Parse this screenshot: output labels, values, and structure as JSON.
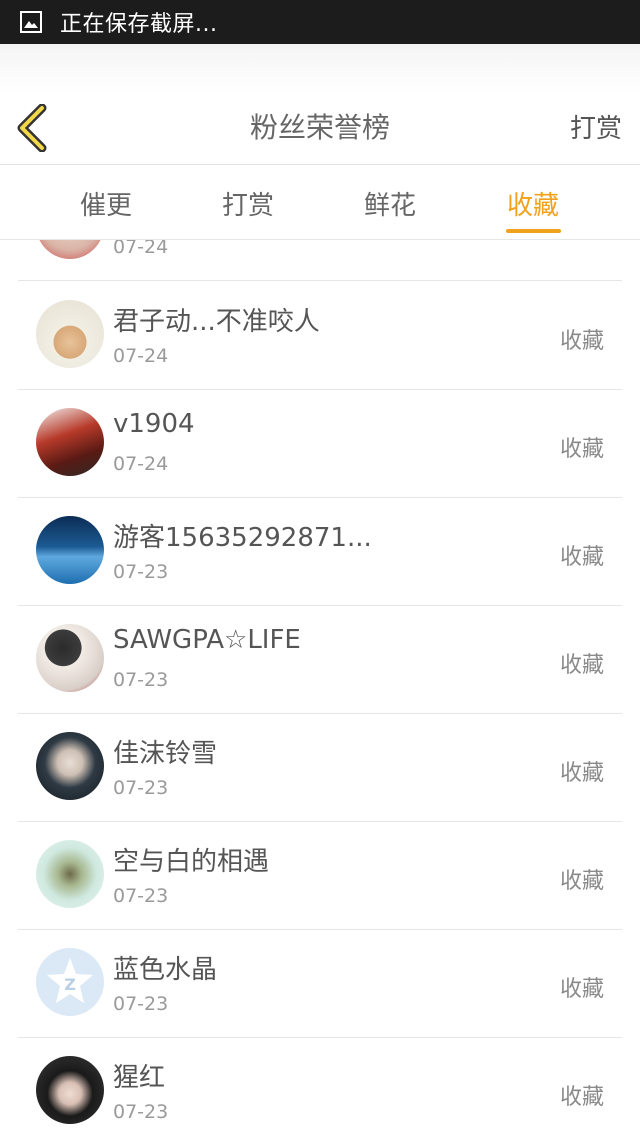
{
  "status_bar": {
    "text": "正在保存截屏..."
  },
  "header": {
    "title": "粉丝荣誉榜",
    "action_label": "打赏"
  },
  "tabs": [
    {
      "label": "催更",
      "active": false
    },
    {
      "label": "打赏",
      "active": false
    },
    {
      "label": "鲜花",
      "active": false
    },
    {
      "label": "收藏",
      "active": true
    }
  ],
  "colors": {
    "accent": "#f0a21d",
    "text": "#555555",
    "muted": "#9a9a9a"
  },
  "list": {
    "partial_top": {
      "date": "07-24"
    },
    "items": [
      {
        "name": "君子动...不准咬人",
        "date": "07-24",
        "action": "收藏"
      },
      {
        "name": "v1904",
        "date": "07-24",
        "action": "收藏"
      },
      {
        "name": "游客15635292871...",
        "date": "07-23",
        "action": "收藏"
      },
      {
        "name": "SAWGPA☆LIFE",
        "date": "07-23",
        "action": "收藏"
      },
      {
        "name": "佳沫铃雪",
        "date": "07-23",
        "action": "收藏"
      },
      {
        "name": "空与白的相遇",
        "date": "07-23",
        "action": "收藏"
      },
      {
        "name": "蓝色水晶",
        "date": "07-23",
        "action": "收藏"
      },
      {
        "name": "猩红",
        "date": "07-23",
        "action": "收藏"
      }
    ]
  }
}
